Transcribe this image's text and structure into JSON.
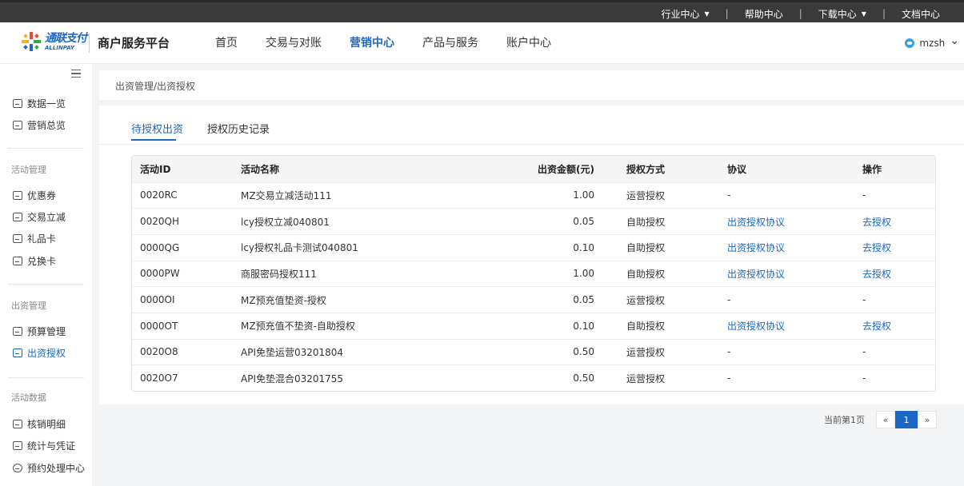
{
  "topbar": {
    "links": [
      {
        "label": "行业中心",
        "dropdown": true
      },
      {
        "label": "帮助中心",
        "dropdown": false
      },
      {
        "label": "下载中心",
        "dropdown": true
      },
      {
        "label": "文档中心",
        "dropdown": false
      }
    ],
    "caret": "▼",
    "separator": "|"
  },
  "header": {
    "logo_cn": "通联支付",
    "logo_en": "ALLINPAY",
    "platform": "商户服务平台",
    "nav": [
      "首页",
      "交易与对账",
      "营销中心",
      "产品与服务",
      "账户中心"
    ],
    "active_nav": "营销中心",
    "username": "mzsh",
    "user_caret": "⌄"
  },
  "sidebar": {
    "top_items": [
      "数据一览",
      "营销总览"
    ],
    "groups": [
      {
        "title": "活动管理",
        "items": [
          "优惠券",
          "交易立减",
          "礼品卡",
          "兑换卡"
        ]
      },
      {
        "title": "出资管理",
        "items": [
          "预算管理",
          "出资授权"
        ]
      },
      {
        "title": "活动数据",
        "items": [
          "核销明细",
          "统计与凭证",
          "预约处理中心"
        ]
      }
    ],
    "active_item": "出资授权"
  },
  "breadcrumb": "出资管理/出资授权",
  "tabs": [
    "待授权出资",
    "授权历史记录"
  ],
  "table": {
    "headers": [
      "活动ID",
      "活动名称",
      "出资金额(元)",
      "授权方式",
      "协议",
      "操作"
    ],
    "rows": [
      [
        "0020RC",
        "MZ交易立减活动111",
        "1.00",
        "运营授权",
        "-",
        "-"
      ],
      [
        "0020QH",
        "lcy授权立减040801",
        "0.05",
        "自助授权",
        "出资授权协议",
        "去授权"
      ],
      [
        "0000QG",
        "lcy授权礼品卡测试040801",
        "0.10",
        "自助授权",
        "出资授权协议",
        "去授权"
      ],
      [
        "0000PW",
        "商服密码授权111",
        "1.00",
        "自助授权",
        "出资授权协议",
        "去授权"
      ],
      [
        "0000OI",
        "MZ预充值垫资-授权",
        "0.05",
        "运营授权",
        "-",
        "-"
      ],
      [
        "0000OT",
        "MZ预充值不垫资-自助授权",
        "0.10",
        "自助授权",
        "出资授权协议",
        "去授权"
      ],
      [
        "0020O8",
        "API免垫运营03201804",
        "0.50",
        "运营授权",
        "-",
        "-"
      ],
      [
        "0020O7",
        "API免垫混合03201755",
        "0.50",
        "运营授权",
        "-",
        "-"
      ]
    ]
  },
  "pagination": {
    "label": "当前第1页",
    "prev": "«",
    "current": "1",
    "next": "»"
  },
  "colors": {
    "accent": "#1d67c4",
    "topbar": "#3a3a3a",
    "background": "#f3f4f6"
  }
}
